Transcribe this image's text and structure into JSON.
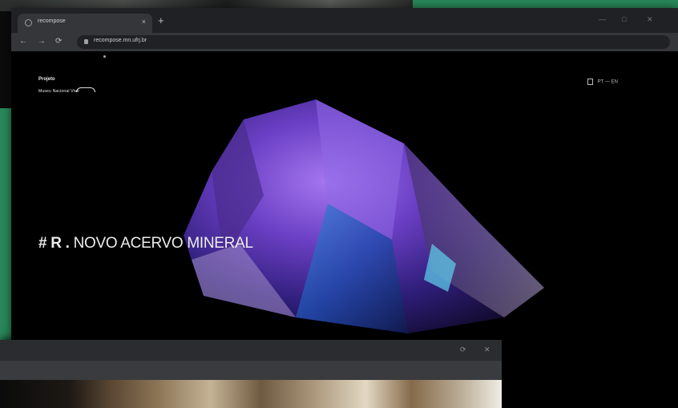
{
  "browser": {
    "tab": {
      "title": "recompose",
      "close_glyph": "×"
    },
    "new_tab_glyph": "+",
    "address": {
      "url": "recompose.mn.ufrj.br"
    },
    "window_controls": [
      "—",
      "□",
      "✕"
    ],
    "nav": {
      "back": "←",
      "forward": "→",
      "reload": "⟳"
    }
  },
  "site": {
    "logo": {
      "line1": "Projeto",
      "line2": "Museu Nacional Vive"
    },
    "language": {
      "current": "PT",
      "separator": "—",
      "alternate": "EN"
    },
    "hero": {
      "prefix": "# R .",
      "title": "NOVO ACERVO MINERAL"
    }
  },
  "second_window": {
    "menu_glyph": "⋮",
    "window_controls": [
      "⟳",
      "✕"
    ]
  },
  "colors": {
    "accent_green": "#2a8a5c",
    "page_bg": "#000000",
    "chrome_dark": "#202124"
  },
  "icons": [
    "globe-icon",
    "close-icon",
    "plus-icon",
    "back-arrow-icon",
    "forward-arrow-icon",
    "reload-icon",
    "lock-icon",
    "document-icon",
    "more-vert-icon"
  ]
}
